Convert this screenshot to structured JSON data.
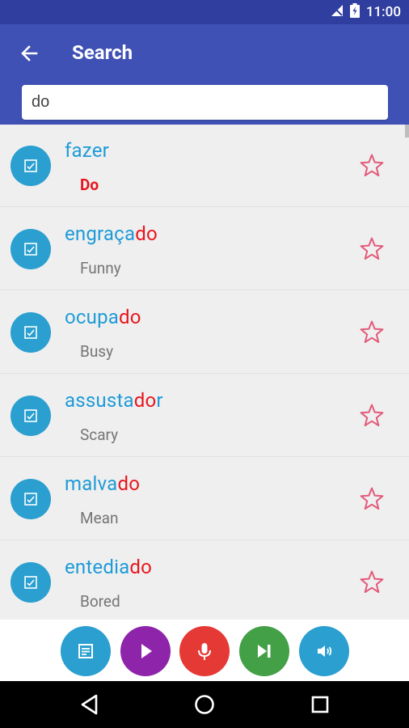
{
  "status_bar": {
    "time": "11:00",
    "icons": [
      "no-signal-icon",
      "battery-icon"
    ]
  },
  "app_bar": {
    "title": "Search",
    "back_icon": "arrow-left-icon"
  },
  "search": {
    "value": "do"
  },
  "list": [
    {
      "word_prefix": "fazer",
      "word_highlight": "",
      "word_suffix": "",
      "translation": "Do",
      "translation_highlighted": true
    },
    {
      "word_prefix": "engraça",
      "word_highlight": "do",
      "word_suffix": "",
      "translation": "Funny",
      "translation_highlighted": false
    },
    {
      "word_prefix": "ocupa",
      "word_highlight": "do",
      "word_suffix": "",
      "translation": "Busy",
      "translation_highlighted": false
    },
    {
      "word_prefix": "assusta",
      "word_highlight": "do",
      "word_suffix": "r",
      "translation": "Scary",
      "translation_highlighted": false
    },
    {
      "word_prefix": "malva",
      "word_highlight": "do",
      "word_suffix": "",
      "translation": "Mean",
      "translation_highlighted": false
    },
    {
      "word_prefix": "entedia",
      "word_highlight": "do",
      "word_suffix": "",
      "translation": "Bored",
      "translation_highlighted": false
    }
  ],
  "controls": [
    {
      "name": "quiz-button",
      "icon": "quiz-icon",
      "color": "#2a9fd0"
    },
    {
      "name": "play-button",
      "icon": "play-icon",
      "color": "#8e24aa"
    },
    {
      "name": "microphone-button",
      "icon": "microphone-icon",
      "color": "#e53935"
    },
    {
      "name": "skip-next-button",
      "icon": "skip-next-icon",
      "color": "#43a047"
    },
    {
      "name": "speaker-button",
      "icon": "speaker-icon",
      "color": "#2a9fd0"
    }
  ],
  "colors": {
    "status_bar": "#303f9f",
    "app_bar": "#3f51b5",
    "word": "#1e9bd7",
    "highlight": "#e8141d",
    "star": "#e35a7a"
  },
  "nav_bar": {
    "icons": [
      "back-triangle-icon",
      "home-circle-icon",
      "recents-square-icon"
    ]
  }
}
